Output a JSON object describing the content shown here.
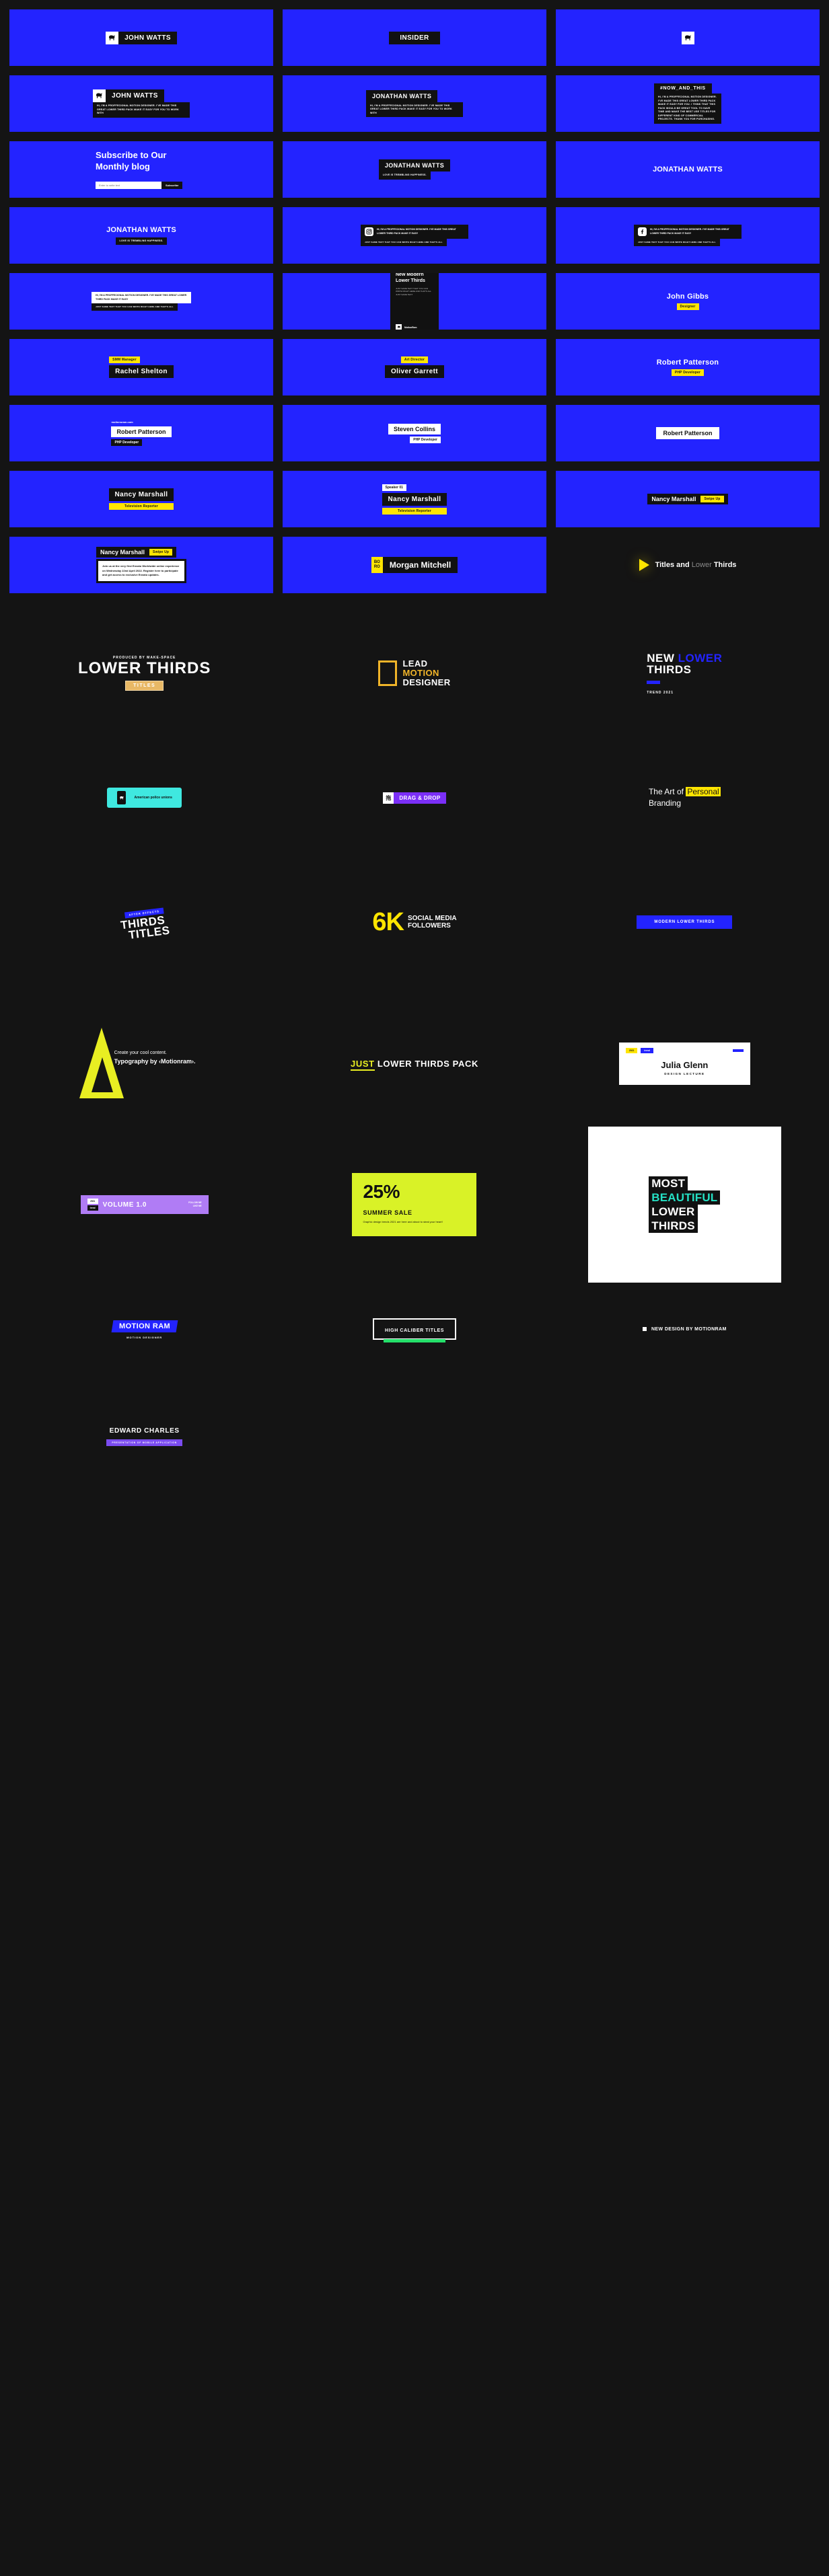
{
  "theme": {
    "bg": "#141414",
    "blue": "#2323ff",
    "yellow": "#ffe500",
    "black": "#111111",
    "white": "#ffffff",
    "lime": "#d9f227",
    "cyan": "#3fe8e0",
    "purple": "#7b2ff7"
  },
  "brand": {
    "name_john": "JOHN WATTS",
    "name_insider": "INSIDER",
    "name_jonathan": "JONATHAN WATTS",
    "hashtag": "#NOW_AND_THIS"
  },
  "body_short": "HI, I'M A PROFFECIONAL MOTION DESIGNER.",
  "body_medium": "HI, I'M A PROFFECIONAL MOTION DESIGNER. I'VE MADE THIS GREAT LOWER THIRD PACK MAKE IT EASY FOR YOU TO WORK WITH",
  "body_long": "HI, I'M A PROFFECIONAL MOTION DESIGNER. I'VE MADE THIS GREAT LOWER THIRD PACK MAKE IT EASY FOR YOU. I THINK THAT THIS PACK WOULD BE GREAT TOOL TO SAVE TIME AND MAKE THE BEST USE TITLES FOR DIFFERENT KIND OF COMMERCIAL PROJECTS. THANK YOU FOR PURCHASING.",
  "body_sub": "HI, I'M A PROFFECIONAL MOTION DESIGNER. I'VE MADE THIS GREAT LOWER THIRD PACK MAKE IT EASY",
  "body_tiny": "JUST SAME TEXT THAT YOU CAN WRITE RIGHT HERE AND THAT'S ALL",
  "subscribe": {
    "heading": "Subscribe to Our Monthly blog",
    "placeholder": "Enter to write text",
    "button": "Subscribe"
  },
  "tagline_love": "LOVE IS TREMBLING HAPPINESS.",
  "phone": {
    "title": "New Modern Lower Thirds",
    "sub": "JUST SAME TEXT THAT YOU CAN WRITE RIGHT HERE AND THAT'S ALL JUST SAME TEXT",
    "footer": "MotionRam"
  },
  "people": [
    {
      "name": "John Gibbs",
      "role": "Designer"
    },
    {
      "name": "Rachel Shelton",
      "role": "SMM Manager"
    },
    {
      "name": "Oliver Garrett",
      "role": "Art Director"
    },
    {
      "name": "Robert Patterson",
      "role": "PHP Developer"
    },
    {
      "name": "Steven Collins",
      "role": "PHP Developer"
    },
    {
      "name": "Nancy Marshall",
      "role": "Television Reporter"
    },
    {
      "name": "Morgan Mitchell",
      "role": "BO RO"
    }
  ],
  "site_url": "motionsram.com",
  "speaker_badge": "Speaker 01",
  "swipe_up": "Swipe Up",
  "popup_text": "Join us at the very first Envato Worldwide online experience on Wednesday 22nd April 2022. Register here to participate and get access to exclusive Envato updates.",
  "titles_and_lower_thirds": {
    "part1": "Titles and",
    "part2": "Lower",
    "part3": "Thirds"
  },
  "dark": {
    "produced_by": "PRODUCED BY MAKE-SPACE",
    "lower_thirds": "LOWER THIRDS",
    "titles_tag": "TITLES",
    "lead": [
      "LEAD",
      "MOTION",
      "DESIGNER"
    ],
    "new_lower": {
      "l1a": "NEW",
      "l1b": "LOWER",
      "l2": "THIRDS",
      "trend": "TREND 2021"
    },
    "police": "American police unions",
    "drag_drop": {
      "glyph": "拖",
      "text": "DRAG & DROP"
    },
    "art_of": {
      "a": "The Art of",
      "hl": "Personal",
      "b": "Branding"
    },
    "thirds_titles": {
      "ae": "AFTER EFFECTS",
      "l1": "THIRDS",
      "l2": "TITLES"
    },
    "six_k": {
      "num": "6K",
      "l1": "SOCIAL MEDIA",
      "l2": "FOLLOWERS"
    },
    "modern": "MODERN LOWER THIRDS",
    "triangle": {
      "l1": "Create your cool content.",
      "l2": "Typography by ‹Motionram›."
    },
    "just_pack": {
      "hl": "JUST",
      "rest": "LOWER THIRDS PACK"
    },
    "julia": {
      "tag1": "2021",
      "tag2": "trend",
      "name": "Julia Glenn",
      "role": "DESIGN LECTURE"
    },
    "volume": {
      "t1": "2021",
      "t2": "trend",
      "title": "VOLUME 1.0",
      "f1": "FOLLOW ME",
      "f2": "LIKE ME"
    },
    "sale": {
      "pct": "25%",
      "label": "SUMMER SALE",
      "desc": "Graphic design trends 2021 are here and about to steal your heart!"
    },
    "most_beautiful": [
      "MOST",
      "BEAUTIFUL",
      "LOWER",
      "THIRDS"
    ],
    "motion_ram": {
      "title": "MOTION RAM",
      "sub": "MOTION DESIGNER"
    },
    "high_caliber": "HIGH CALIBER TITLES",
    "new_design": "NEW DESIGN BY MOTIONRAM",
    "edward": {
      "name": "EDWARD CHARLES",
      "role": "PRESENTATION OF MOBILE APPLICATION"
    }
  }
}
